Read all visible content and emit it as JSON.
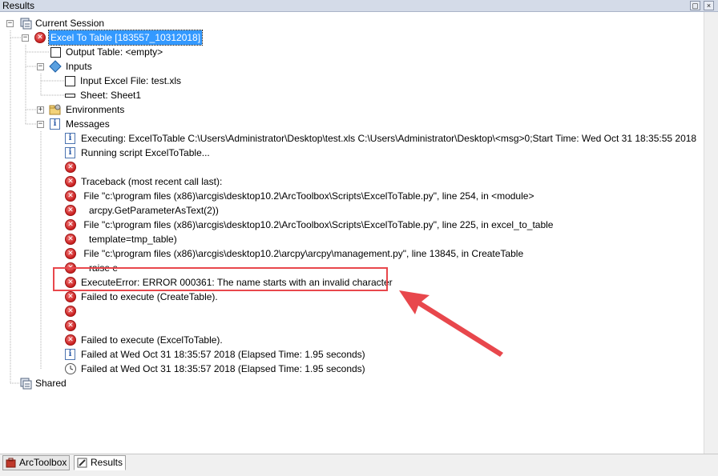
{
  "window": {
    "title": "Results",
    "pin_glyph": "▢",
    "close_glyph": "×"
  },
  "tree": {
    "root_label": "Current Session",
    "tool_label": "Excel To Table [183557_10312018]",
    "output_table": "Output Table: <empty>",
    "inputs_label": "Inputs",
    "input_excel": "Input Excel File: test.xls",
    "sheet": "Sheet: Sheet1",
    "environments_label": "Environments",
    "messages_label": "Messages",
    "messages": [
      {
        "type": "info",
        "text": "Executing: ExcelToTable C:\\Users\\Administrator\\Desktop\\test.xls C:\\Users\\Administrator\\Desktop\\<msg>0;Start Time: Wed Oct 31 18:35:55 2018"
      },
      {
        "type": "info",
        "text": "Running script ExcelToTable..."
      },
      {
        "type": "error",
        "text": ""
      },
      {
        "type": "error",
        "text": "Traceback (most recent call last):"
      },
      {
        "type": "error",
        "text": " File \"c:\\program files (x86)\\arcgis\\desktop10.2\\ArcToolbox\\Scripts\\ExcelToTable.py\", line 254, in <module>"
      },
      {
        "type": "error",
        "text": "   arcpy.GetParameterAsText(2))"
      },
      {
        "type": "error",
        "text": " File \"c:\\program files (x86)\\arcgis\\desktop10.2\\ArcToolbox\\Scripts\\ExcelToTable.py\", line 225, in excel_to_table"
      },
      {
        "type": "error",
        "text": "   template=tmp_table)"
      },
      {
        "type": "error",
        "text": " File \"c:\\program files (x86)\\arcgis\\desktop10.2\\arcpy\\arcpy\\management.py\", line 13845, in CreateTable"
      },
      {
        "type": "error",
        "text": "   raise e"
      },
      {
        "type": "error",
        "text": "ExecuteError: ERROR 000361: The name starts with an invalid character"
      },
      {
        "type": "error",
        "text": "Failed to execute (CreateTable)."
      },
      {
        "type": "error",
        "text": ""
      },
      {
        "type": "error",
        "text": ""
      },
      {
        "type": "error",
        "text": "Failed to execute (ExcelToTable)."
      },
      {
        "type": "info",
        "text": "Failed at Wed Oct 31 18:35:57 2018 (Elapsed Time: 1.95 seconds)"
      },
      {
        "type": "clock",
        "text": "Failed at Wed Oct 31 18:35:57 2018 (Elapsed Time: 1.95 seconds)"
      }
    ],
    "shared_label": "Shared"
  },
  "tabs": [
    {
      "label": "ArcToolbox",
      "active": false
    },
    {
      "label": "Results",
      "active": true
    }
  ],
  "colors": {
    "highlight_box": "#e8474c",
    "arrow": "#e8474c",
    "selection": "#3399ff"
  }
}
